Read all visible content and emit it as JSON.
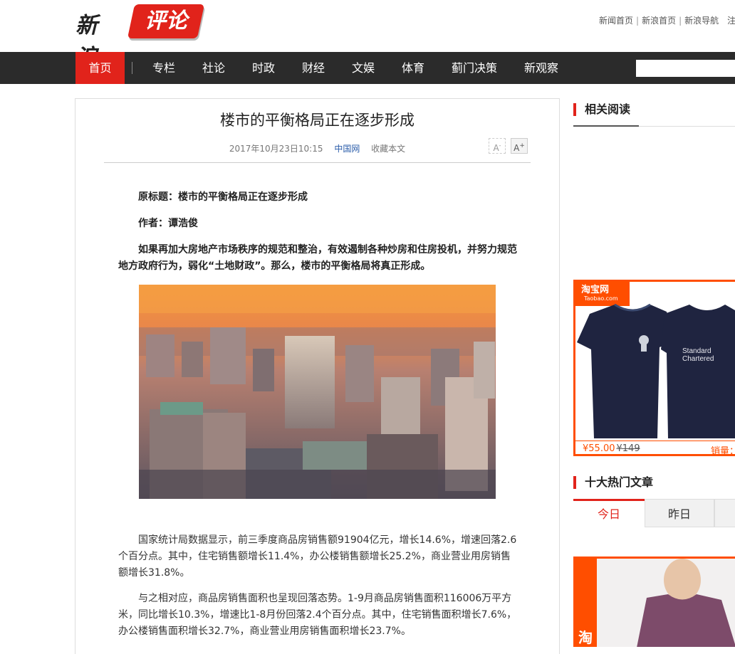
{
  "logo": {
    "part1": "新浪",
    "part2": "评论"
  },
  "toplinks": [
    "新闻首页",
    "新浪首页",
    "新浪导航",
    "注"
  ],
  "toplinks_sep": "|",
  "nav": {
    "items": [
      "首页",
      "专栏",
      "社论",
      "时政",
      "财经",
      "文娱",
      "体育",
      "蓟门决策",
      "新观察"
    ],
    "active": "首页"
  },
  "article": {
    "title": "楼市的平衡格局正在逐步形成",
    "date": "2017年10月23日10:15",
    "source": "中国网",
    "collect": "收藏本文",
    "font_small": "A-",
    "font_big": "A+",
    "original_title": "原标题：楼市的平衡格局正在逐步形成",
    "author": "作者：谭浩俊",
    "lead": "如果再加大房地产市场秩序的规范和整治，有效遏制各种炒房和住房投机，并努力规范地方政府行为，弱化“土地财政”。那么，楼市的平衡格局将真正形成。",
    "para1": "国家统计局数据显示，前三季度商品房销售额91904亿元，增长14.6%，增速回落2.6个百分点。其中，住宅销售额增长11.4%，办公楼销售额增长25.2%，商业营业用房销售额增长31.8%。",
    "para2": "与之相对应，商品房销售面积也呈现回落态势。1-9月商品房销售面积116006万平方米，同比增长10.3%，增速比1-8月份回落2.4个百分点。其中，住宅销售面积增长7.6%，办公楼销售面积增长32.7%，商业营业用房销售面积增长23.7%。"
  },
  "sidebar": {
    "related_title": "相关阅读",
    "hot_title": "十大热门文章",
    "tabs": [
      "今日",
      "昨日"
    ],
    "ad": {
      "brand": "淘宝网",
      "brand_en": "Taobao.com",
      "shirt_text_1": "Standard",
      "shirt_text_2": "Chartered",
      "price": "¥55.00",
      "old_price": "¥149",
      "sales": "销量：",
      "accent": "#ff4e00"
    },
    "ad2": {
      "brand": "淘宝"
    }
  },
  "colors": {
    "brand_red": "#e1231b",
    "nav_bg": "#2b2b2b"
  }
}
